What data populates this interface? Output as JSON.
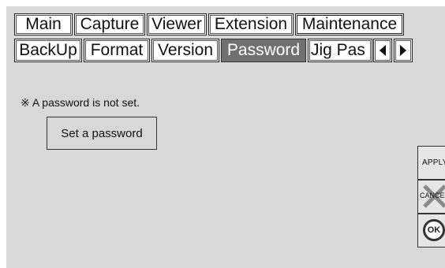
{
  "main_tabs": [
    "Main",
    "Capture",
    "Viewer",
    "Extension",
    "Maintenance"
  ],
  "sub_tabs": [
    "BackUp",
    "Format",
    "Version",
    "Password",
    "Jig Pas"
  ],
  "selected_main_tab": "Maintenance",
  "selected_sub_tab": "Password",
  "content": {
    "notice": "※ A password is not set.",
    "set_password_label": "Set a password"
  },
  "side_buttons": {
    "apply_label": "APPLY",
    "cancel_label": "CANCEL",
    "ok_label": "OK"
  },
  "colors": {
    "panel_bg": "#d8d8d8",
    "selected_tab_bg": "#707070"
  },
  "icons": {
    "scroll_left": "arrow-left-icon",
    "scroll_right": "arrow-right-icon",
    "cancel": "cancel-x-icon"
  }
}
